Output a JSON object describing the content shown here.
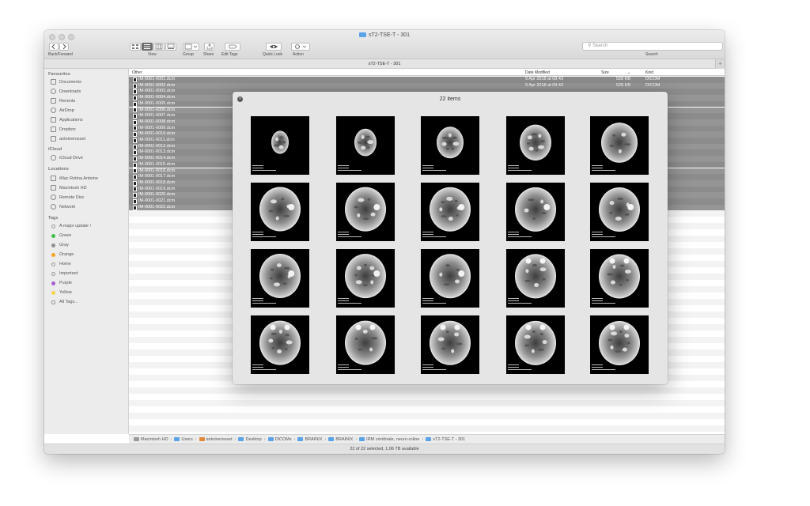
{
  "window": {
    "title": "sT2-TSE-T - 301",
    "path_title": "sT2-TSE-T - 301",
    "plus_label": "+"
  },
  "toolbar": {
    "back_forward_label": "Back/Forward",
    "view_label": "View",
    "group_label": "Group",
    "share_label": "Share",
    "edit_tags_label": "Edit Tags",
    "quick_look_label": "Quick Look",
    "action_label": "Action",
    "search_label": "Search",
    "search_placeholder": "Search"
  },
  "sidebar": {
    "favourites_header": "Favourites",
    "favourites": [
      "Documents",
      "Downloads",
      "Recents",
      "AirDrop",
      "Applications",
      "Dropbox",
      "antoinerosset"
    ],
    "icloud_header": "iCloud",
    "icloud": [
      "iCloud Drive"
    ],
    "locations_header": "Locations",
    "locations": [
      "iMac Retina Antoine",
      "Macintosh HD",
      "Remote Disc",
      "Network"
    ],
    "tags_header": "Tags",
    "tags": [
      {
        "label": "A major update !",
        "color": "#ffffff"
      },
      {
        "label": "Green",
        "color": "#3fbf4a"
      },
      {
        "label": "Gray",
        "color": "#8e8e93"
      },
      {
        "label": "Orange",
        "color": "#f5a623"
      },
      {
        "label": "Home",
        "color": "#ffffff"
      },
      {
        "label": "Important",
        "color": "#ffffff"
      },
      {
        "label": "Purple",
        "color": "#a65fd1"
      },
      {
        "label": "Yellow",
        "color": "#f5d547"
      },
      {
        "label": "All Tags...",
        "color": "#cccccc"
      }
    ]
  },
  "columns": {
    "name": "Other",
    "date": "Date Modified",
    "size": "Size",
    "kind": "Kind"
  },
  "files": [
    {
      "name": "IM-0001-0001.dcm",
      "date": "9 Apr 2018 at 09:43",
      "size": "528 KB",
      "kind": "DICOM"
    },
    {
      "name": "IM-0001-0002.dcm",
      "date": "9 Apr 2018 at 09:43",
      "size": "528 KB",
      "kind": "DICOM"
    },
    {
      "name": "IM-0001-0003.dcm"
    },
    {
      "name": "IM-0001-0004.dcm"
    },
    {
      "name": "IM-0001-0005.dcm"
    },
    {
      "name": "IM-0001-0006.dcm"
    },
    {
      "name": "IM-0001-0007.dcm"
    },
    {
      "name": "IM-0001-0008.dcm"
    },
    {
      "name": "IM-0001-0009.dcm"
    },
    {
      "name": "IM-0001-0010.dcm"
    },
    {
      "name": "IM-0001-0011.dcm"
    },
    {
      "name": "IM-0001-0012.dcm"
    },
    {
      "name": "IM-0001-0013.dcm"
    },
    {
      "name": "IM-0001-0014.dcm"
    },
    {
      "name": "IM-0001-0015.dcm"
    },
    {
      "name": "IM-0001-0016.dcm"
    },
    {
      "name": "IM-0001-0017.dcm"
    },
    {
      "name": "IM-0001-0018.dcm"
    },
    {
      "name": "IM-0001-0019.dcm"
    },
    {
      "name": "IM-0001-0020.dcm"
    },
    {
      "name": "IM-0001-0021.dcm"
    },
    {
      "name": "IM-0001-0022.dcm"
    }
  ],
  "quicklook": {
    "title": "22 items",
    "close_glyph": "×",
    "thumbnails": [
      "IM-0001-0001.dcm",
      "IM-0001-0002.dcm",
      "IM-0001-0003.dcm",
      "IM-0001-0004.dcm",
      "IM-0001-0005.dcm",
      "IM-0001-0006.dcm",
      "IM-0001-0007.dcm",
      "IM-0001-0008.dcm",
      "IM-0001-0009.dcm",
      "IM-0001-0010.dcm",
      "IM-0001-0011.dcm",
      "IM-0001-0012.dcm",
      "IM-0001-0013.dcm",
      "IM-0001-0014.dcm",
      "IM-0001-0015.dcm",
      "IM-0001-0016.dcm",
      "IM-0001-0017.dcm",
      "IM-0001-0018.dcm",
      "IM-0001-0019.dcm",
      "IM-0001-0020.dcm"
    ]
  },
  "breadcrumb": [
    "Macintosh HD",
    "Users",
    "antoinerosset",
    "Desktop",
    "DICOMs",
    "BRAINIX",
    "BRAINIX",
    "IRM cérébrale, neuro-crâne",
    "sT2-TSE-T - 301"
  ],
  "breadcrumb_separator": "›",
  "status": "22 of 22 selected, 1.06 TB available",
  "colors": {
    "accent_folder": "#5aa3e6",
    "selection": "#8c8c8c"
  },
  "icons": {
    "back": "chevron-left-icon",
    "forward": "chevron-right-icon",
    "quick_look": "eye-icon",
    "action": "gear-icon",
    "share": "share-icon",
    "edit_tags": "tag-icon"
  }
}
